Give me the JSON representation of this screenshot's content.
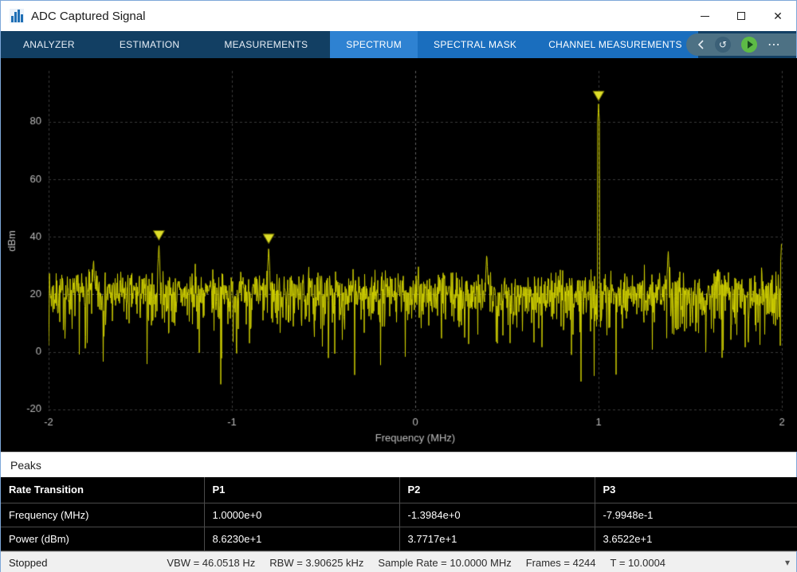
{
  "window": {
    "title": "ADC Captured Signal"
  },
  "icons": {
    "close_glyph": "✕",
    "step_back_glyph": "↺",
    "more_glyph": "⋯",
    "status_arrow_glyph": "▾"
  },
  "tabs": {
    "main": [
      "ANALYZER",
      "ESTIMATION",
      "MEASUREMENTS"
    ],
    "contextual": [
      "SPECTRUM",
      "SPECTRAL MASK",
      "CHANNEL MEASUREMENTS"
    ],
    "active_contextual": "SPECTRUM"
  },
  "colors": {
    "toolstrip_dark_blue": "#123f63",
    "contextual_blue": "#1a6ebe",
    "active_tab_blue": "#2e82d2",
    "plot_background": "#000000",
    "run_button_green": "#5dbb46"
  },
  "chart_data": {
    "type": "line",
    "title": "",
    "xlabel": "Frequency (MHz)",
    "ylabel": "dBm",
    "xlim": [
      -2,
      2
    ],
    "ylim": [
      -20.6,
      97.7
    ],
    "xticks": [
      -2,
      -1,
      0,
      1,
      2
    ],
    "yticks": [
      -20,
      0,
      20,
      40,
      60,
      80
    ],
    "grid": true,
    "emphasized_ytick": 20,
    "emphasized_xtick": 0,
    "line_color": "#d0d000",
    "marker_color": "#dede2a",
    "marker_edge_color": "#6b6b00",
    "axis_text_color": "#bdbdbd",
    "noise_floor_dbm": 21.5,
    "noise_seed": 7,
    "markers": [
      {
        "label": "P1",
        "freq_mhz": 1.0,
        "power_dbm": 86.23
      },
      {
        "label": "P2",
        "freq_mhz": -1.3984,
        "power_dbm": 37.717
      },
      {
        "label": "P3",
        "freq_mhz": -0.79948,
        "power_dbm": 36.522
      }
    ],
    "spikes": [
      {
        "freq_mhz": 1.0,
        "power_dbm": 86.23
      },
      {
        "freq_mhz": -1.3984,
        "power_dbm": 37.717
      },
      {
        "freq_mhz": -0.79948,
        "power_dbm": 36.522
      },
      {
        "freq_mhz": -1.755,
        "power_dbm": 32.5
      },
      {
        "freq_mhz": 0.39,
        "power_dbm": 34.5
      },
      {
        "freq_mhz": 1.38,
        "power_dbm": 35.5
      },
      {
        "freq_mhz": 1.999,
        "power_dbm": 39.0
      }
    ]
  },
  "peaks_panel": {
    "title": "Peaks"
  },
  "table": {
    "headers": [
      "Rate Transition",
      "P1",
      "P2",
      "P3"
    ],
    "rows": [
      [
        "Frequency (MHz)",
        "1.0000e+0",
        "-1.3984e+0",
        "-7.9948e-1"
      ],
      [
        "Power (dBm)",
        "8.6230e+1",
        "3.7717e+1",
        "3.6522e+1"
      ]
    ]
  },
  "status_bar": {
    "state": "Stopped",
    "vbw": "VBW = 46.0518 Hz",
    "rbw": "RBW = 3.90625 kHz",
    "sample_rate": "Sample Rate = 10.0000 MHz",
    "frames": "Frames = 4244",
    "t": "T = 10.0004"
  }
}
